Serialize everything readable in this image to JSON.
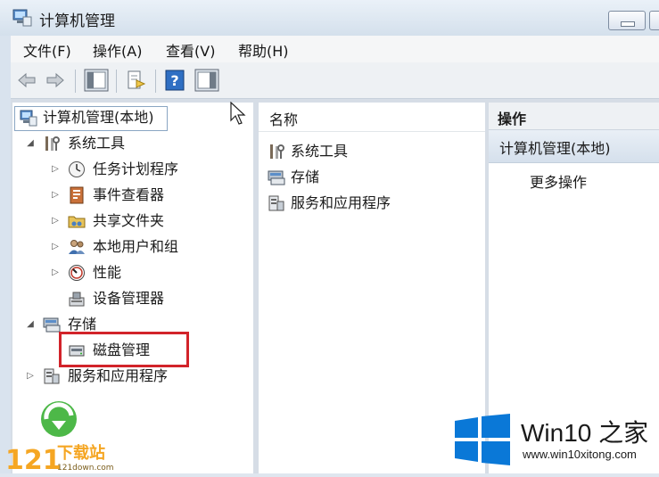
{
  "window": {
    "title": "计算机管理"
  },
  "menu": [
    "文件(F)",
    "操作(A)",
    "查看(V)",
    "帮助(H)"
  ],
  "toolbar": {
    "icons": [
      "back-arrow-icon",
      "forward-arrow-icon",
      "show-hide-tree-icon",
      "export-list-icon",
      "help-icon",
      "show-hide-action-pane-icon"
    ]
  },
  "tree": {
    "root": "计算机管理(本地)",
    "system_tools": "系统工具",
    "task_scheduler": "任务计划程序",
    "event_viewer": "事件查看器",
    "shared_folders": "共享文件夹",
    "local_users": "本地用户和组",
    "performance": "性能",
    "device_manager": "设备管理器",
    "storage": "存储",
    "disk_management": "磁盘管理",
    "services_apps": "服务和应用程序"
  },
  "list": {
    "header": "名称",
    "items": [
      "系统工具",
      "存储",
      "服务和应用程序"
    ]
  },
  "actions": {
    "header": "操作",
    "group": "计算机管理(本地)",
    "more": "更多操作"
  },
  "watermark": {
    "left_brand": "下载站",
    "left_num": "121",
    "left_url": "121down.com",
    "right_brand": "Win10 之家",
    "right_url": "www.win10xitong.com"
  },
  "colors": {
    "highlight": "#d2232a",
    "win_blue": "#0a78d7"
  }
}
